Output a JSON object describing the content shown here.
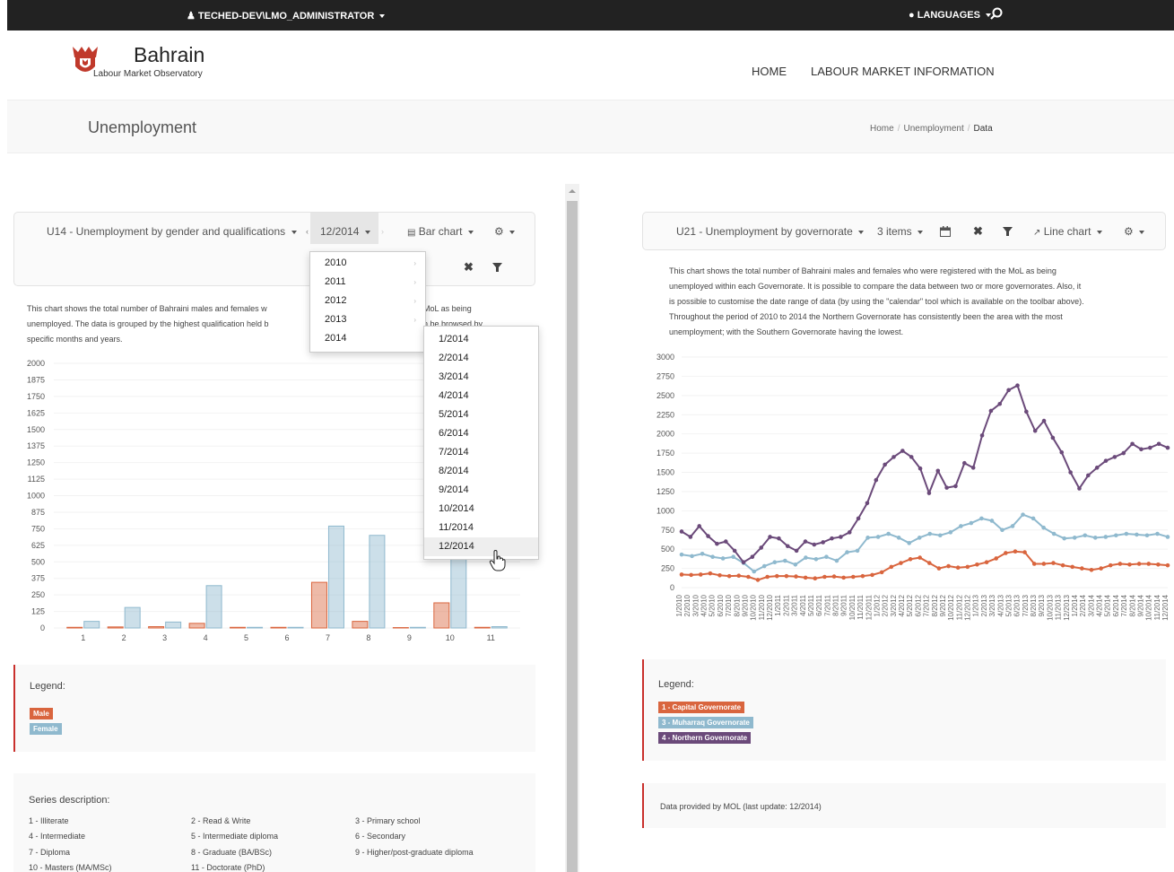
{
  "topbar": {
    "user_label": "TECHED-DEV\\LMO_ADMINISTRATOR",
    "languages_label": "LANGUAGES"
  },
  "logo": {
    "title": "Bahrain",
    "subtitle": "Labour Market Observatory"
  },
  "nav": {
    "items": [
      "HOME",
      "LABOUR MARKET INFORMATION"
    ]
  },
  "page": {
    "title": "Unemployment",
    "breadcrumb": [
      "Home",
      "Unemployment",
      "Data"
    ]
  },
  "left_panel": {
    "toolbar": {
      "dataset": "U14 - Unemployment by gender and qualifications",
      "date": "12/2014",
      "chart_type": "Bar chart"
    },
    "description": [
      "This chart shows the total number of Bahraini males and females w",
      "unemployed. The data is grouped by the highest qualification held b",
      "specific months and years.",
      "MoL as being",
      "n be browsed by"
    ],
    "year_dropdown": [
      "2010",
      "2011",
      "2012",
      "2013",
      "2014"
    ],
    "month_dropdown": [
      "1/2014",
      "2/2014",
      "3/2014",
      "4/2014",
      "5/2014",
      "6/2014",
      "7/2014",
      "8/2014",
      "9/2014",
      "10/2014",
      "11/2014",
      "12/2014"
    ],
    "legend": {
      "title": "Legend:",
      "items": [
        {
          "label": "Male",
          "color": "#d9653e"
        },
        {
          "label": "Female",
          "color": "#8fb9ce"
        }
      ]
    },
    "series_description": {
      "title": "Series description:",
      "items": [
        "1 - Illiterate",
        "2 - Read & Write",
        "3 - Primary school",
        "4 - Intermediate",
        "5 - Intermediate diploma",
        "6 - Secondary",
        "7 - Diploma",
        "8 - Graduate (BA/BSc)",
        "9 - Higher/post-graduate diploma",
        "10 - Masters (MA/MSc)",
        "11 - Doctorate (PhD)"
      ]
    }
  },
  "right_panel": {
    "toolbar": {
      "dataset": "U21 - Unemployment by governorate",
      "items": "3 items",
      "chart_type": "Line chart"
    },
    "description": [
      "This chart shows the total number of Bahraini males and females who were registered with the MoL as being",
      "unemployed within each Governorate. It is possible to compare the data between two or more governorates. Also, it",
      "is possible to customise the date range of data (by using the \"calendar\" tool which is available on the toolbar above).",
      "Throughout the period of 2010 to 2014 the Northern Governorate has consistently been the area with the most",
      "unemployment; with the Southern Governorate having the lowest."
    ],
    "legend": {
      "title": "Legend:",
      "items": [
        {
          "label": "1 - Capital Governorate",
          "color": "#d9653e"
        },
        {
          "label": "3 - Muharraq Governorate",
          "color": "#8fb9ce"
        },
        {
          "label": "4 - Northern Governorate",
          "color": "#6b4a7a"
        }
      ]
    },
    "info": "Data provided by MOL (last update: 12/2014)"
  },
  "chart_data": [
    {
      "type": "bar",
      "categories": [
        "1",
        "2",
        "3",
        "4",
        "5",
        "6",
        "7",
        "8",
        "9",
        "10",
        "11"
      ],
      "series": [
        {
          "name": "Male",
          "color": "#d9653e",
          "values": [
            5,
            8,
            10,
            35,
            5,
            5,
            345,
            50,
            3,
            190,
            5
          ]
        },
        {
          "name": "Female",
          "color": "#8fb9ce",
          "values": [
            50,
            155,
            45,
            320,
            5,
            5,
            770,
            700,
            5,
            575,
            10
          ]
        }
      ],
      "yticks": [
        0,
        125,
        250,
        375,
        500,
        625,
        750,
        875,
        1000,
        1125,
        1250,
        1375,
        1500,
        1625,
        1750,
        1875,
        2000
      ],
      "ylim": [
        0,
        2000
      ]
    },
    {
      "type": "line",
      "x": [
        "1/2010",
        "2/2010",
        "3/2010",
        "4/2010",
        "5/2010",
        "6/2010",
        "7/2010",
        "8/2010",
        "9/2010",
        "10/2010",
        "11/2010",
        "12/2010",
        "1/2011",
        "2/2011",
        "3/2011",
        "4/2011",
        "5/2011",
        "6/2011",
        "7/2011",
        "8/2011",
        "9/2011",
        "10/2011",
        "11/2011",
        "12/2011",
        "1/2012",
        "2/2012",
        "3/2012",
        "4/2012",
        "5/2012",
        "6/2012",
        "7/2012",
        "8/2012",
        "9/2012",
        "10/2012",
        "11/2012",
        "12/2012",
        "1/2013",
        "2/2013",
        "3/2013",
        "4/2013",
        "5/2013",
        "6/2013",
        "7/2013",
        "8/2013",
        "9/2013",
        "10/2013",
        "11/2013",
        "12/2013",
        "1/2014",
        "2/2014",
        "3/2014",
        "4/2014",
        "5/2014",
        "6/2014",
        "7/2014",
        "8/2014",
        "9/2014",
        "10/2014",
        "11/2014",
        "12/2014"
      ],
      "series": [
        {
          "name": "1 - Capital Governorate",
          "color": "#d9653e",
          "values": [
            170,
            165,
            170,
            185,
            160,
            150,
            155,
            140,
            100,
            140,
            150,
            150,
            145,
            130,
            120,
            140,
            145,
            130,
            140,
            150,
            165,
            200,
            270,
            320,
            370,
            390,
            320,
            250,
            280,
            260,
            270,
            300,
            330,
            380,
            450,
            470,
            460,
            310,
            310,
            320,
            290,
            270,
            250,
            230,
            250,
            290,
            310,
            300,
            310,
            310,
            300,
            290
          ]
        },
        {
          "name": "3 - Muharraq Governorate",
          "color": "#8fb9ce",
          "values": [
            430,
            410,
            440,
            400,
            380,
            400,
            320,
            210,
            280,
            330,
            350,
            300,
            390,
            370,
            400,
            350,
            460,
            480,
            650,
            660,
            700,
            650,
            580,
            650,
            700,
            680,
            720,
            800,
            840,
            900,
            870,
            750,
            800,
            950,
            900,
            780,
            700,
            640,
            650,
            680,
            650,
            660,
            680,
            700,
            690,
            680,
            700,
            660
          ]
        },
        {
          "name": "4 - Northern Governorate",
          "color": "#6b4a7a",
          "values": [
            730,
            660,
            800,
            670,
            570,
            600,
            480,
            330,
            400,
            520,
            660,
            640,
            540,
            480,
            600,
            560,
            590,
            640,
            660,
            720,
            900,
            1100,
            1400,
            1600,
            1700,
            1780,
            1700,
            1550,
            1230,
            1520,
            1300,
            1320,
            1620,
            1560,
            1980,
            2300,
            2390,
            2570,
            2630,
            2290,
            2040,
            2170,
            1950,
            1760,
            1500,
            1290,
            1460,
            1560,
            1650,
            1700,
            1750,
            1870,
            1800,
            1820,
            1870,
            1820
          ]
        }
      ],
      "yticks": [
        0,
        250,
        500,
        750,
        1000,
        1250,
        1500,
        1750,
        2000,
        2250,
        2500,
        2750,
        3000
      ],
      "ylim": [
        0,
        3000
      ]
    }
  ]
}
